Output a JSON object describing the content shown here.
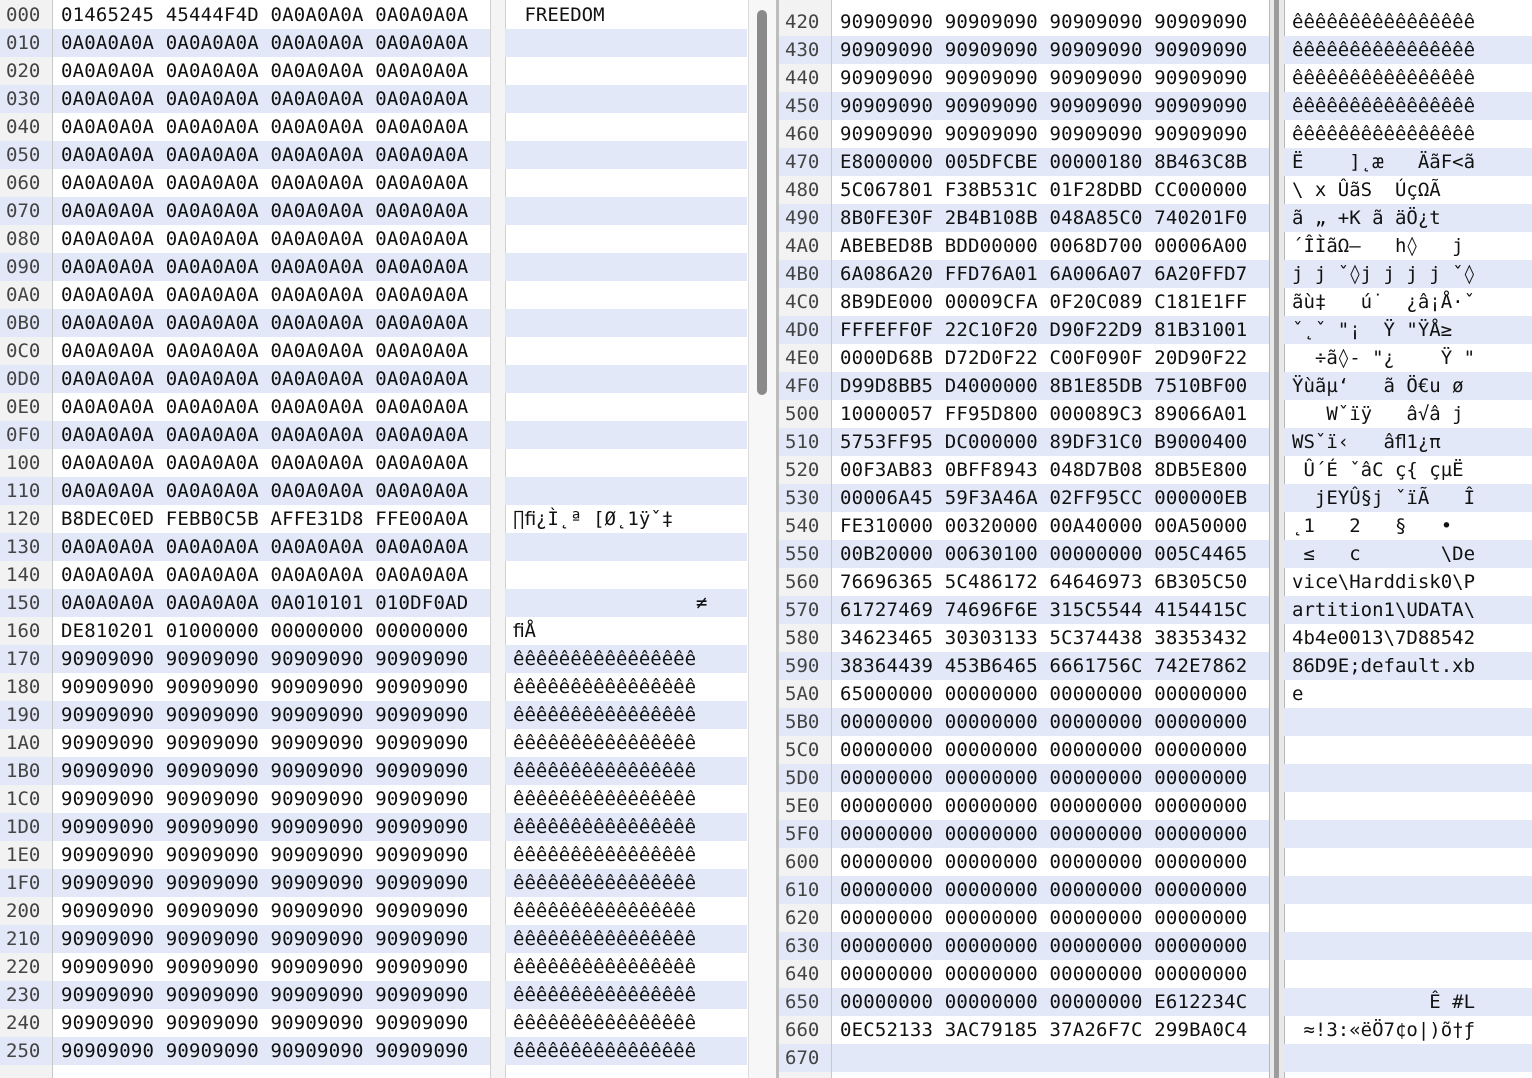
{
  "left": {
    "rows": [
      {
        "off": "000",
        "hex": "01465245 45444F4D 0A0A0A0A 0A0A0A0A",
        "ascii": " FREEDOM"
      },
      {
        "off": "010",
        "hex": "0A0A0A0A 0A0A0A0A 0A0A0A0A 0A0A0A0A",
        "ascii": ""
      },
      {
        "off": "020",
        "hex": "0A0A0A0A 0A0A0A0A 0A0A0A0A 0A0A0A0A",
        "ascii": ""
      },
      {
        "off": "030",
        "hex": "0A0A0A0A 0A0A0A0A 0A0A0A0A 0A0A0A0A",
        "ascii": ""
      },
      {
        "off": "040",
        "hex": "0A0A0A0A 0A0A0A0A 0A0A0A0A 0A0A0A0A",
        "ascii": ""
      },
      {
        "off": "050",
        "hex": "0A0A0A0A 0A0A0A0A 0A0A0A0A 0A0A0A0A",
        "ascii": ""
      },
      {
        "off": "060",
        "hex": "0A0A0A0A 0A0A0A0A 0A0A0A0A 0A0A0A0A",
        "ascii": ""
      },
      {
        "off": "070",
        "hex": "0A0A0A0A 0A0A0A0A 0A0A0A0A 0A0A0A0A",
        "ascii": ""
      },
      {
        "off": "080",
        "hex": "0A0A0A0A 0A0A0A0A 0A0A0A0A 0A0A0A0A",
        "ascii": ""
      },
      {
        "off": "090",
        "hex": "0A0A0A0A 0A0A0A0A 0A0A0A0A 0A0A0A0A",
        "ascii": ""
      },
      {
        "off": "0A0",
        "hex": "0A0A0A0A 0A0A0A0A 0A0A0A0A 0A0A0A0A",
        "ascii": ""
      },
      {
        "off": "0B0",
        "hex": "0A0A0A0A 0A0A0A0A 0A0A0A0A 0A0A0A0A",
        "ascii": ""
      },
      {
        "off": "0C0",
        "hex": "0A0A0A0A 0A0A0A0A 0A0A0A0A 0A0A0A0A",
        "ascii": ""
      },
      {
        "off": "0D0",
        "hex": "0A0A0A0A 0A0A0A0A 0A0A0A0A 0A0A0A0A",
        "ascii": ""
      },
      {
        "off": "0E0",
        "hex": "0A0A0A0A 0A0A0A0A 0A0A0A0A 0A0A0A0A",
        "ascii": ""
      },
      {
        "off": "0F0",
        "hex": "0A0A0A0A 0A0A0A0A 0A0A0A0A 0A0A0A0A",
        "ascii": ""
      },
      {
        "off": "100",
        "hex": "0A0A0A0A 0A0A0A0A 0A0A0A0A 0A0A0A0A",
        "ascii": ""
      },
      {
        "off": "110",
        "hex": "0A0A0A0A 0A0A0A0A 0A0A0A0A 0A0A0A0A",
        "ascii": ""
      },
      {
        "off": "120",
        "hex": "B8DEC0ED FEBB0C5B AFFE31D8 FFE00A0A",
        "ascii": "∏ﬁ¿Ì˛ª [Ø˛1ÿˇ‡"
      },
      {
        "off": "130",
        "hex": "0A0A0A0A 0A0A0A0A 0A0A0A0A 0A0A0A0A",
        "ascii": ""
      },
      {
        "off": "140",
        "hex": "0A0A0A0A 0A0A0A0A 0A0A0A0A 0A0A0A0A",
        "ascii": ""
      },
      {
        "off": "150",
        "hex": "0A0A0A0A 0A0A0A0A 0A010101 010DF0AD",
        "ascii": "                ≠"
      },
      {
        "off": "160",
        "hex": "DE810201 01000000 00000000 00000000",
        "ascii": "ﬁÅ"
      },
      {
        "off": "170",
        "hex": "90909090 90909090 90909090 90909090",
        "ascii": "êêêêêêêêêêêêêêêê"
      },
      {
        "off": "180",
        "hex": "90909090 90909090 90909090 90909090",
        "ascii": "êêêêêêêêêêêêêêêê"
      },
      {
        "off": "190",
        "hex": "90909090 90909090 90909090 90909090",
        "ascii": "êêêêêêêêêêêêêêêê"
      },
      {
        "off": "1A0",
        "hex": "90909090 90909090 90909090 90909090",
        "ascii": "êêêêêêêêêêêêêêêê"
      },
      {
        "off": "1B0",
        "hex": "90909090 90909090 90909090 90909090",
        "ascii": "êêêêêêêêêêêêêêêê"
      },
      {
        "off": "1C0",
        "hex": "90909090 90909090 90909090 90909090",
        "ascii": "êêêêêêêêêêêêêêêê"
      },
      {
        "off": "1D0",
        "hex": "90909090 90909090 90909090 90909090",
        "ascii": "êêêêêêêêêêêêêêêê"
      },
      {
        "off": "1E0",
        "hex": "90909090 90909090 90909090 90909090",
        "ascii": "êêêêêêêêêêêêêêêê"
      },
      {
        "off": "1F0",
        "hex": "90909090 90909090 90909090 90909090",
        "ascii": "êêêêêêêêêêêêêêêê"
      },
      {
        "off": "200",
        "hex": "90909090 90909090 90909090 90909090",
        "ascii": "êêêêêêêêêêêêêêêê"
      },
      {
        "off": "210",
        "hex": "90909090 90909090 90909090 90909090",
        "ascii": "êêêêêêêêêêêêêêêê"
      },
      {
        "off": "220",
        "hex": "90909090 90909090 90909090 90909090",
        "ascii": "êêêêêêêêêêêêêêêê"
      },
      {
        "off": "230",
        "hex": "90909090 90909090 90909090 90909090",
        "ascii": "êêêêêêêêêêêêêêêê"
      },
      {
        "off": "240",
        "hex": "90909090 90909090 90909090 90909090",
        "ascii": "êêêêêêêêêêêêêêêê"
      },
      {
        "off": "250",
        "hex": "90909090 90909090 90909090 90909090",
        "ascii": "êêêêêêêêêêêêêêêê"
      }
    ]
  },
  "right": {
    "rows": [
      {
        "off": "420",
        "hex": "90909090 90909090 90909090 90909090",
        "ascii": "êêêêêêêêêêêêêêêê"
      },
      {
        "off": "430",
        "hex": "90909090 90909090 90909090 90909090",
        "ascii": "êêêêêêêêêêêêêêêê"
      },
      {
        "off": "440",
        "hex": "90909090 90909090 90909090 90909090",
        "ascii": "êêêêêêêêêêêêêêêê"
      },
      {
        "off": "450",
        "hex": "90909090 90909090 90909090 90909090",
        "ascii": "êêêêêêêêêêêêêêêê"
      },
      {
        "off": "460",
        "hex": "90909090 90909090 90909090 90909090",
        "ascii": "êêêêêêêêêêêêêêêê"
      },
      {
        "off": "470",
        "hex": "E8000000 005DFCBE 00000180 8B463C8B",
        "ascii": "Ë    ]˛æ   ÄãF<ã"
      },
      {
        "off": "480",
        "hex": "5C067801 F38B531C 01F28DBD CC000000",
        "ascii": "\\ x ÛãS  ÚçΩÃ"
      },
      {
        "off": "490",
        "hex": "8B0FE30F 2B4B108B 048A85C0 740201F0",
        "ascii": "ã „ +K ã äÖ¿t  "
      },
      {
        "off": "4A0",
        "hex": "ABEBED8B BDD00000 0068D700 00006A00",
        "ascii": "´ÎÌãΩ–   h◊   j"
      },
      {
        "off": "4B0",
        "hex": "6A086A20 FFD76A01 6A006A07 6A20FFD7",
        "ascii": "j j ˇ◊j j j j ˇ◊"
      },
      {
        "off": "4C0",
        "hex": "8B9DE000 00009CFA 0F20C089 C181E1FF",
        "ascii": "ãù‡   ú˙  ¿â¡Å·ˇ"
      },
      {
        "off": "4D0",
        "hex": "FFFEFF0F 22C10F20 D90F22D9 81B31001",
        "ascii": "ˇ˛ˇ \"¡  Ÿ \"ŸÅ≥"
      },
      {
        "off": "4E0",
        "hex": "0000D68B D72D0F22 C00F090F 20D90F22",
        "ascii": "  ÷ã◊- \"¿    Ÿ \""
      },
      {
        "off": "4F0",
        "hex": "D99D8BB5 D4000000 8B1E85DB 7510BF00",
        "ascii": "Ÿùãµ‘   ã Ö€u ø"
      },
      {
        "off": "500",
        "hex": "10000057 FF95D800 000089C3 89066A01",
        "ascii": "   Wˇïÿ   â√â j"
      },
      {
        "off": "510",
        "hex": "5753FF95 DC000000 89DF31C0 B9000400",
        "ascii": "WSˇï‹   âﬂ1¿π"
      },
      {
        "off": "520",
        "hex": "00F3AB83 0BFF8943 048D7B08 8DB5E800",
        "ascii": " Û´É ˇâC ç{ çµË"
      },
      {
        "off": "530",
        "hex": "00006A45 59F3A46A 02FF95CC 000000EB",
        "ascii": "  jEYÛ§j ˇïÃ   Î"
      },
      {
        "off": "540",
        "hex": "FE310000 00320000 00A40000 00A50000",
        "ascii": "˛1   2   §   •"
      },
      {
        "off": "550",
        "hex": "00B20000 00630100 00000000 005C4465",
        "ascii": " ≤   c       \\De"
      },
      {
        "off": "560",
        "hex": "76696365 5C486172 64646973 6B305C50",
        "ascii": "vice\\Harddisk0\\P"
      },
      {
        "off": "570",
        "hex": "61727469 74696F6E 315C5544 4154415C",
        "ascii": "artition1\\UDATA\\"
      },
      {
        "off": "580",
        "hex": "34623465 30303133 5C374438 38353432",
        "ascii": "4b4e0013\\7D88542"
      },
      {
        "off": "590",
        "hex": "38364439 453B6465 6661756C 742E7862",
        "ascii": "86D9E;default.xb"
      },
      {
        "off": "5A0",
        "hex": "65000000 00000000 00000000 00000000",
        "ascii": "e"
      },
      {
        "off": "5B0",
        "hex": "00000000 00000000 00000000 00000000",
        "ascii": ""
      },
      {
        "off": "5C0",
        "hex": "00000000 00000000 00000000 00000000",
        "ascii": ""
      },
      {
        "off": "5D0",
        "hex": "00000000 00000000 00000000 00000000",
        "ascii": ""
      },
      {
        "off": "5E0",
        "hex": "00000000 00000000 00000000 00000000",
        "ascii": ""
      },
      {
        "off": "5F0",
        "hex": "00000000 00000000 00000000 00000000",
        "ascii": ""
      },
      {
        "off": "600",
        "hex": "00000000 00000000 00000000 00000000",
        "ascii": ""
      },
      {
        "off": "610",
        "hex": "00000000 00000000 00000000 00000000",
        "ascii": ""
      },
      {
        "off": "620",
        "hex": "00000000 00000000 00000000 00000000",
        "ascii": ""
      },
      {
        "off": "630",
        "hex": "00000000 00000000 00000000 00000000",
        "ascii": ""
      },
      {
        "off": "640",
        "hex": "00000000 00000000 00000000 00000000",
        "ascii": ""
      },
      {
        "off": "650",
        "hex": "00000000 00000000 00000000 E612234C",
        "ascii": "            Ê #L"
      },
      {
        "off": "660",
        "hex": "0EC52133 3AC79185 37A26F7C 299BA0C4",
        "ascii": " ≈!3:«ëÖ7¢o|)õ†ƒ"
      },
      {
        "off": "670",
        "hex": "",
        "ascii": ""
      }
    ]
  }
}
